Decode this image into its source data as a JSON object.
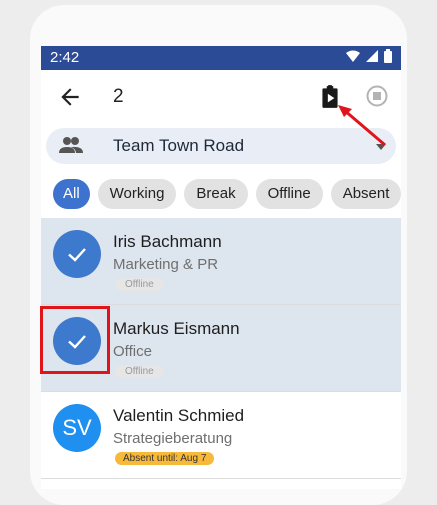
{
  "status_bar": {
    "time": "2:42"
  },
  "app_bar": {
    "selected_count": "2"
  },
  "team_selector": {
    "name": "Team Town Road"
  },
  "filters": [
    {
      "label": "All",
      "active": true
    },
    {
      "label": "Working",
      "active": false
    },
    {
      "label": "Break",
      "active": false
    },
    {
      "label": "Offline",
      "active": false
    },
    {
      "label": "Absent",
      "active": false
    }
  ],
  "members": [
    {
      "name": "Iris Bachmann",
      "department": "Marketing & PR",
      "status": "Offline",
      "selected": true
    },
    {
      "name": "Markus Eismann",
      "department": "Office",
      "status": "Offline",
      "selected": true
    },
    {
      "name": "Valentin Schmied",
      "department": "Strategieberatung",
      "status": "Absent until: Aug 7",
      "initials": "SV",
      "selected": false
    }
  ],
  "colors": {
    "status_bar": "#2c4b96",
    "accent": "#3d72cf",
    "selected_row": "#dde5ef",
    "absent_badge": "#f7b93a",
    "annotation": "#e0141b"
  }
}
